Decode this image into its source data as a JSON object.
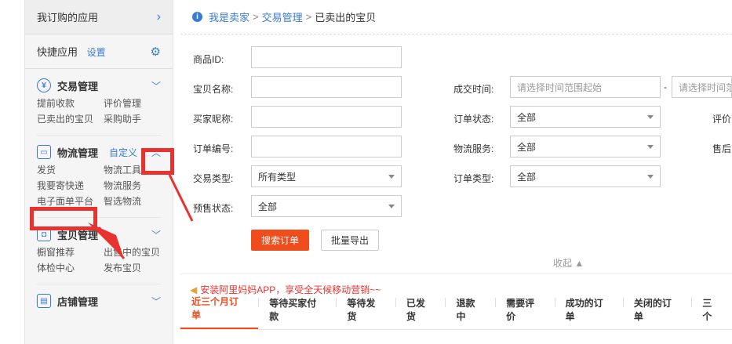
{
  "sidebar": {
    "my_apps": "我订购的应用",
    "quick_apps": "快捷应用",
    "quick_settings": "设置",
    "sections": [
      {
        "title": "交易管理",
        "items": [
          "提前收款",
          "评价管理",
          "已卖出的宝贝",
          "采购助手"
        ]
      },
      {
        "title": "物流管理",
        "custom": "自定义",
        "items": [
          "发货",
          "物流工具",
          "我要寄快递",
          "物流服务",
          "电子面单平台",
          "智选物流"
        ]
      },
      {
        "title": "宝贝管理",
        "items": [
          "橱窗推荐",
          "出售中的宝贝",
          "体检中心",
          "发布宝贝"
        ]
      },
      {
        "title": "店铺管理",
        "items": []
      }
    ]
  },
  "breadcrumb": {
    "home": "我是卖家",
    "sep": ">",
    "trade": "交易管理",
    "current": "已卖出的宝贝"
  },
  "form": {
    "product_id": "商品ID:",
    "item_name": "宝贝名称:",
    "buyer_nick": "买家昵称:",
    "order_no": "订单编号:",
    "trade_type": "交易类型:",
    "trade_type_value": "所有类型",
    "presale_status": "预售状态:",
    "presale_value": "全部",
    "deal_time": "成交时间:",
    "time_start_placeholder": "请选择时间范围起始",
    "time_dash": "-",
    "time_end_placeholder": "请选择时间范",
    "order_status": "订单状态:",
    "order_status_value": "全部",
    "logistics_service": "物流服务:",
    "logistics_value": "全部",
    "order_type": "订单类型:",
    "order_type_value": "全部",
    "rating": "评价",
    "after_sale": "售后"
  },
  "buttons": {
    "search": "搜索订单",
    "export": "批量导出",
    "collapse": "收起"
  },
  "promo": "安装阿里妈妈APP，享受全天候移动营销~~",
  "tabs": [
    "近三个月订单",
    "等待买家付款",
    "等待发货",
    "已发货",
    "退款中",
    "需要评价",
    "成功的订单",
    "关闭的订单",
    "三个"
  ]
}
